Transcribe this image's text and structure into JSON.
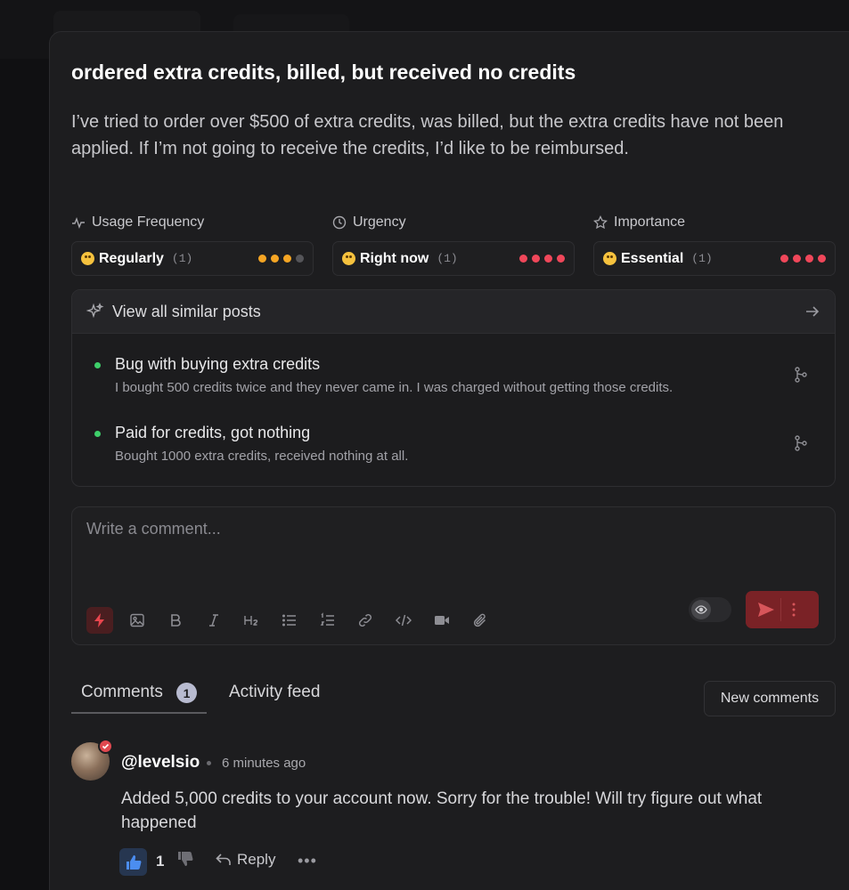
{
  "post": {
    "title": "ordered extra credits, billed, but received no credits",
    "description": "I’ve tried to order over $500 of extra credits, was billed, but the extra credits have not been applied.  If I’m not going to receive the credits, I’d like to be reimbursed."
  },
  "metrics": [
    {
      "label": "Usage Frequency",
      "value": "Regularly",
      "count": "(1)",
      "level": 3,
      "max": 4,
      "color": "#f5a524"
    },
    {
      "label": "Urgency",
      "value": "Right now",
      "count": "(1)",
      "level": 4,
      "max": 4,
      "color": "#f0475a"
    },
    {
      "label": "Importance",
      "value": "Essential",
      "count": "(1)",
      "level": 4,
      "max": 4,
      "color": "#f0475a"
    }
  ],
  "similar": {
    "header": "View all similar posts",
    "posts": [
      {
        "title": "Bug with buying extra credits",
        "subtitle": "I bought 500 credits twice and they never came in. I was charged without getting those credits."
      },
      {
        "title": "Paid for credits, got nothing",
        "subtitle": "Bought 1000 extra credits, received nothing at all."
      }
    ]
  },
  "composer": {
    "placeholder": "Write a comment..."
  },
  "tabs": {
    "comments_label": "Comments",
    "comments_count": "1",
    "activity_label": "Activity feed",
    "new_comments_label": "New comments"
  },
  "comment": {
    "author": "@levelsio",
    "time": "6 minutes ago",
    "body": "Added 5,000 credits to your account now. Sorry for the trouble! Will try figure out what happened",
    "likes": "1",
    "reply_label": "Reply",
    "more_label": "•••"
  },
  "colors": {
    "positive_dot": "#3ecf6a",
    "accent_send": "#7a2226",
    "badge": "#b8bbd0"
  }
}
